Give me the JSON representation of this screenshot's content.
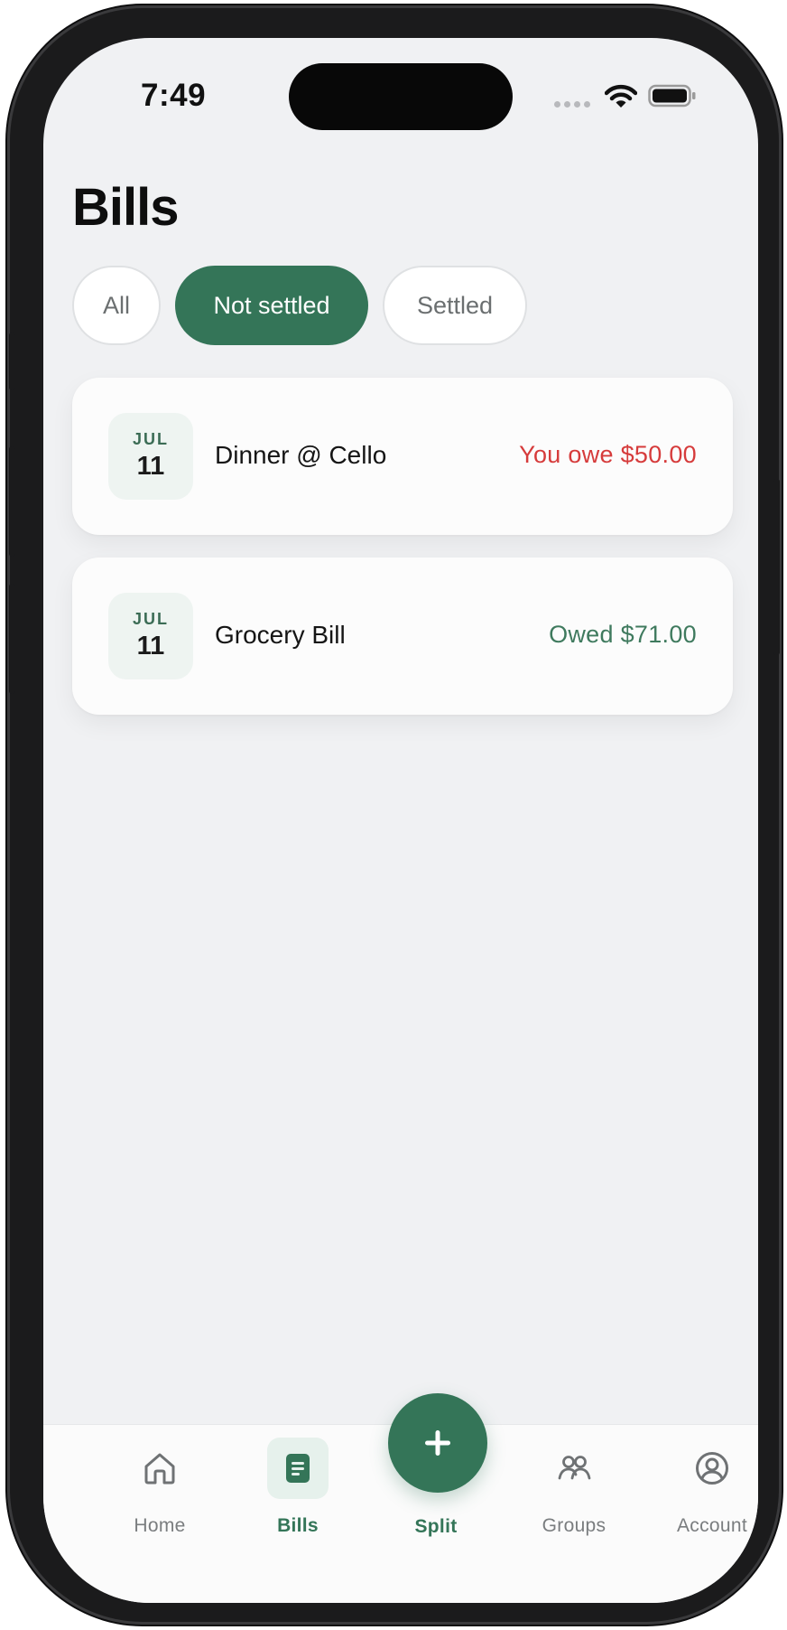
{
  "status_bar": {
    "time": "7:49"
  },
  "page": {
    "title": "Bills"
  },
  "filters": [
    {
      "label": "All",
      "active": false
    },
    {
      "label": "Not settled",
      "active": true
    },
    {
      "label": "Settled",
      "active": false
    }
  ],
  "bills": [
    {
      "month": "JUL",
      "day": "11",
      "name": "Dinner @ Cello",
      "amount": "You owe $50.00",
      "amount_color": "#d63b3b"
    },
    {
      "month": "JUL",
      "day": "11",
      "name": "Grocery Bill",
      "amount": "Owed $71.00",
      "amount_color": "#3f7a5e"
    }
  ],
  "tab_bar": {
    "items": [
      {
        "label": "Home",
        "icon": "home-icon",
        "active": false
      },
      {
        "label": "Bills",
        "icon": "receipt-icon",
        "active": true
      },
      {
        "label": "Split",
        "icon": "plus-icon",
        "active": false
      },
      {
        "label": "Groups",
        "icon": "users-icon",
        "active": false
      },
      {
        "label": "Account",
        "icon": "user-circle-icon",
        "active": false
      }
    ]
  },
  "colors": {
    "accent": "#347558",
    "owe": "#d63b3b",
    "owed": "#3f7a5e",
    "background": "#f0f1f3"
  }
}
